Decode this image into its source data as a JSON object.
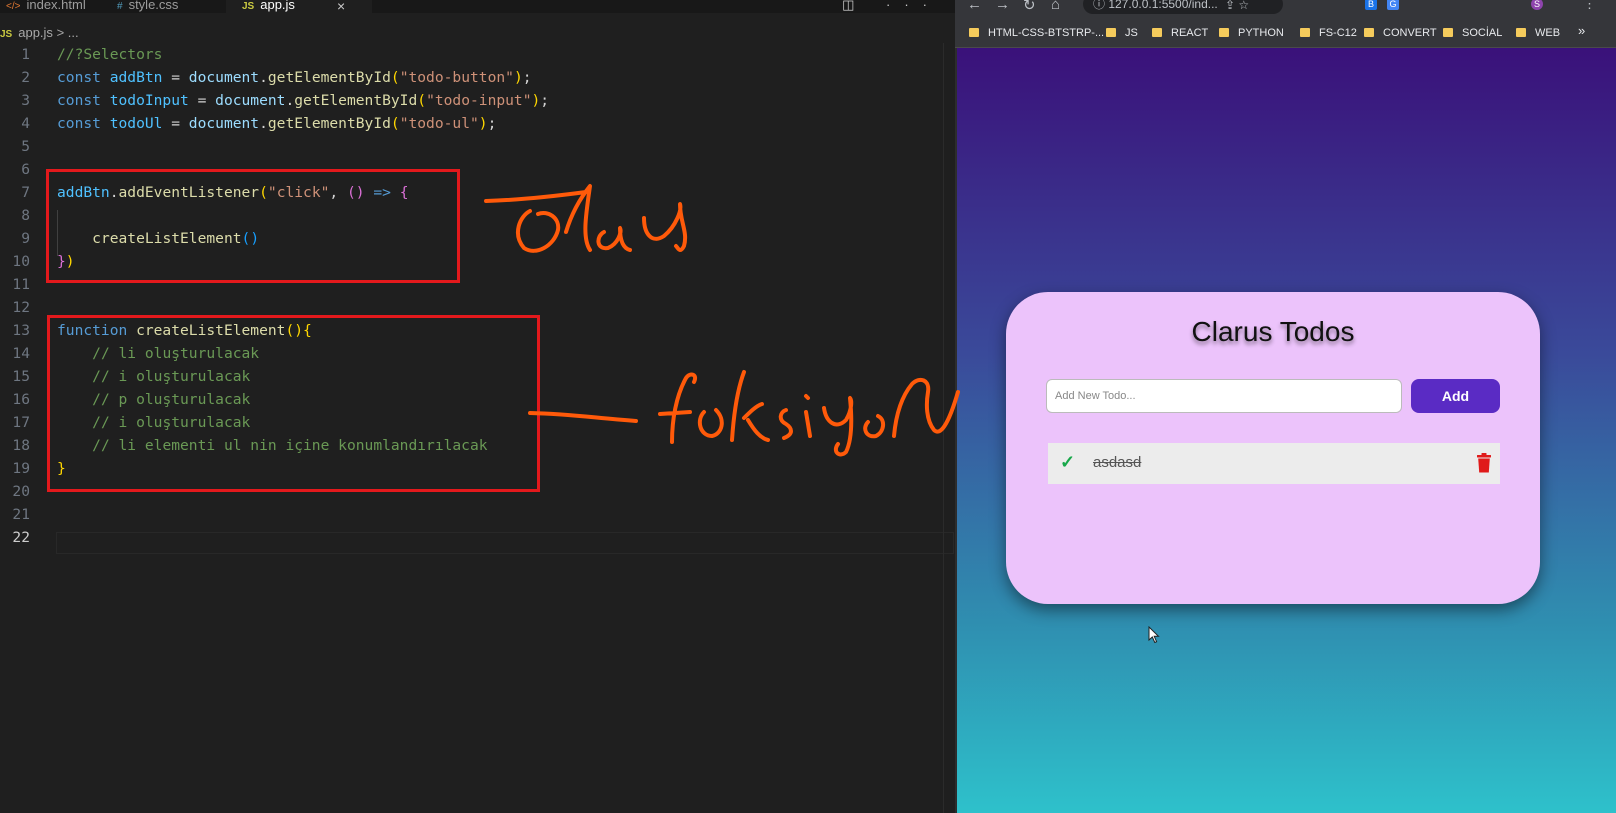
{
  "editor": {
    "tabs": [
      {
        "icon": "</>",
        "label": "index.html",
        "active": false
      },
      {
        "icon": "#",
        "label": "style.css",
        "active": false
      },
      {
        "icon": "JS",
        "label": "app.js",
        "active": true
      }
    ],
    "close_glyph": "×",
    "actions": "◫ ···",
    "breadcrumb": {
      "icon": "JS",
      "file": "app.js",
      "sep": ">",
      "tail": "..."
    },
    "current_line": 22,
    "lines": [
      {
        "n": "1",
        "tokens": [
          {
            "c": "cm",
            "t": "//?Selectors"
          }
        ]
      },
      {
        "n": "2",
        "tokens": [
          {
            "c": "kw",
            "t": "const "
          },
          {
            "c": "vr",
            "t": "addBtn"
          },
          {
            "c": "pl",
            "t": " = "
          },
          {
            "c": "pr",
            "t": "document"
          },
          {
            "c": "pl",
            "t": "."
          },
          {
            "c": "fn",
            "t": "getElementById"
          },
          {
            "c": "br1",
            "t": "("
          },
          {
            "c": "st",
            "t": "\"todo-button\""
          },
          {
            "c": "br1",
            "t": ")"
          },
          {
            "c": "pl",
            "t": ";"
          }
        ]
      },
      {
        "n": "3",
        "tokens": [
          {
            "c": "kw",
            "t": "const "
          },
          {
            "c": "vr",
            "t": "todoInput"
          },
          {
            "c": "pl",
            "t": " = "
          },
          {
            "c": "pr",
            "t": "document"
          },
          {
            "c": "pl",
            "t": "."
          },
          {
            "c": "fn",
            "t": "getElementById"
          },
          {
            "c": "br1",
            "t": "("
          },
          {
            "c": "st",
            "t": "\"todo-input\""
          },
          {
            "c": "br1",
            "t": ")"
          },
          {
            "c": "pl",
            "t": ";"
          }
        ]
      },
      {
        "n": "4",
        "tokens": [
          {
            "c": "kw",
            "t": "const "
          },
          {
            "c": "vr",
            "t": "todoUl"
          },
          {
            "c": "pl",
            "t": " = "
          },
          {
            "c": "pr",
            "t": "document"
          },
          {
            "c": "pl",
            "t": "."
          },
          {
            "c": "fn",
            "t": "getElementById"
          },
          {
            "c": "br1",
            "t": "("
          },
          {
            "c": "st",
            "t": "\"todo-ul\""
          },
          {
            "c": "br1",
            "t": ")"
          },
          {
            "c": "pl",
            "t": ";"
          }
        ]
      },
      {
        "n": "5",
        "tokens": []
      },
      {
        "n": "6",
        "tokens": []
      },
      {
        "n": "7",
        "tokens": [
          {
            "c": "vr",
            "t": "addBtn"
          },
          {
            "c": "pl",
            "t": "."
          },
          {
            "c": "fn",
            "t": "addEventListener"
          },
          {
            "c": "br1",
            "t": "("
          },
          {
            "c": "st",
            "t": "\"click\""
          },
          {
            "c": "pl",
            "t": ", "
          },
          {
            "c": "br2",
            "t": "()"
          },
          {
            "c": "pl",
            "t": " "
          },
          {
            "c": "kw",
            "t": "=>"
          },
          {
            "c": "pl",
            "t": " "
          },
          {
            "c": "br2",
            "t": "{"
          }
        ]
      },
      {
        "n": "8",
        "tokens": []
      },
      {
        "n": "9",
        "tokens": [
          {
            "c": "pl",
            "t": "    "
          },
          {
            "c": "fn",
            "t": "createListElement"
          },
          {
            "c": "br3",
            "t": "()"
          }
        ]
      },
      {
        "n": "10",
        "tokens": [
          {
            "c": "br2",
            "t": "}"
          },
          {
            "c": "br1",
            "t": ")"
          }
        ]
      },
      {
        "n": "11",
        "tokens": []
      },
      {
        "n": "12",
        "tokens": []
      },
      {
        "n": "13",
        "tokens": [
          {
            "c": "kw",
            "t": "function "
          },
          {
            "c": "fn",
            "t": "createListElement"
          },
          {
            "c": "br1",
            "t": "(){"
          }
        ]
      },
      {
        "n": "14",
        "tokens": [
          {
            "c": "pl",
            "t": "    "
          },
          {
            "c": "cm",
            "t": "// li oluşturulacak"
          }
        ]
      },
      {
        "n": "15",
        "tokens": [
          {
            "c": "pl",
            "t": "    "
          },
          {
            "c": "cm",
            "t": "// i oluşturulacak"
          }
        ]
      },
      {
        "n": "16",
        "tokens": [
          {
            "c": "pl",
            "t": "    "
          },
          {
            "c": "cm",
            "t": "// p oluşturulacak"
          }
        ]
      },
      {
        "n": "17",
        "tokens": [
          {
            "c": "pl",
            "t": "    "
          },
          {
            "c": "cm",
            "t": "// i oluşturulacak"
          }
        ]
      },
      {
        "n": "18",
        "tokens": [
          {
            "c": "pl",
            "t": "    "
          },
          {
            "c": "cm",
            "t": "// li elementi ul nin içine konumlandırılacak"
          }
        ]
      },
      {
        "n": "19",
        "tokens": [
          {
            "c": "br1",
            "t": "}"
          }
        ]
      },
      {
        "n": "20",
        "tokens": []
      },
      {
        "n": "21",
        "tokens": []
      },
      {
        "n": "22",
        "tokens": []
      }
    ]
  },
  "annotations": {
    "words": [
      "olay",
      "fonksiyon"
    ],
    "color": "#ff5a0a",
    "box_color": "#e3191c"
  },
  "browser": {
    "nav": {
      "back": "←",
      "forward": "→",
      "reload": "↻",
      "home": "⌂"
    },
    "url": "ⓘ 127.0.0.1:5500/ind...",
    "url_actions": "⇪ ☆",
    "extensions": [
      {
        "label": "B",
        "color": "#1a73e8"
      },
      {
        "label": "G",
        "color": "#4285f4"
      },
      {
        "label": "S",
        "color": "#8e44ad"
      }
    ],
    "bookmarks": [
      "HTML-CSS-BTSTRP-...",
      "JS",
      "REACT",
      "PYTHON",
      "FS-C12",
      "CONVERT",
      "SOCİAL",
      "WEB"
    ],
    "bookmarks_more": "»",
    "app": {
      "title": "Clarus Todos",
      "input_placeholder": "Add New Todo...",
      "input_value": "",
      "add_label": "Add",
      "todos": [
        {
          "text": "asdasd",
          "done": true
        }
      ],
      "check_glyph": "✓"
    }
  }
}
